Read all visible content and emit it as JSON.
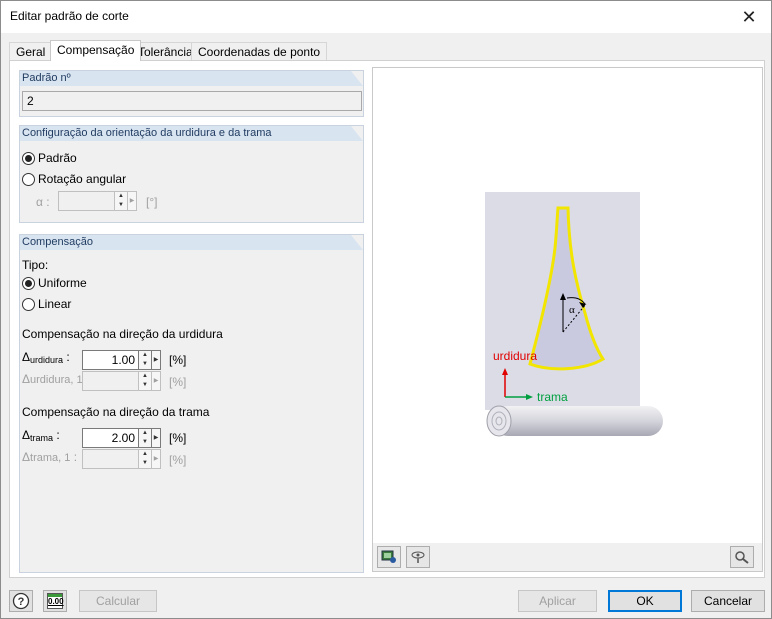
{
  "window": {
    "title": "Editar padrão de corte",
    "close_glyph": "✕"
  },
  "tabs": [
    {
      "label": "Geral",
      "active": false
    },
    {
      "label": "Compensação",
      "active": true
    },
    {
      "label": "Tolerância",
      "active": false
    },
    {
      "label": "Coordenadas de ponto",
      "active": false
    }
  ],
  "pattern_no": {
    "heading": "Padrão nº",
    "value": "2"
  },
  "orientation": {
    "heading": "Configuração da orientação da urdidura e da trama",
    "option_default": "Padrão",
    "option_rotation": "Rotação angular",
    "selected": "default",
    "alpha_label": "α :",
    "alpha_value": "",
    "alpha_unit": "[°]"
  },
  "compensation": {
    "heading": "Compensação",
    "type_label": "Tipo:",
    "option_uniform": "Uniforme",
    "option_linear": "Linear",
    "selected": "uniform",
    "warp_section": "Compensação na direção da urdidura",
    "warp_symbol": "Δ",
    "warp_sub": "urdidura",
    "warp_suffix": " :",
    "warp_value": "1.00",
    "warp_unit": "[%]",
    "warp1_symbol": "Δ",
    "warp1_sub": "urdidura, 1",
    "warp1_suffix": " :",
    "warp1_value": "",
    "warp1_unit": "[%]",
    "weft_section": "Compensação na direção da trama",
    "weft_symbol": "Δ",
    "weft_sub": "trama",
    "weft_suffix": " :",
    "weft_value": "2.00",
    "weft_unit": "[%]",
    "weft1_symbol": "Δ",
    "weft1_sub": "trama, 1",
    "weft1_suffix": " :",
    "weft1_value": "",
    "weft1_unit": "[%]"
  },
  "preview": {
    "warp_label": "urdidura",
    "weft_label": "trama",
    "alpha_label": "α",
    "colors": {
      "pattern_fill": "#c9c9e0",
      "pattern_outline": "#f2e600",
      "warp_axis": "#e00000",
      "weft_axis": "#00a040",
      "fabric": "#dcdce6"
    },
    "icons": [
      "display-settings-icon",
      "view-options-icon",
      "reset-view-icon"
    ]
  },
  "footer": {
    "help_icon": "help-icon",
    "units_icon": "units-icon",
    "units_text": "0.00",
    "calculate": "Calcular",
    "apply": "Aplicar",
    "ok": "OK",
    "cancel": "Cancelar"
  }
}
